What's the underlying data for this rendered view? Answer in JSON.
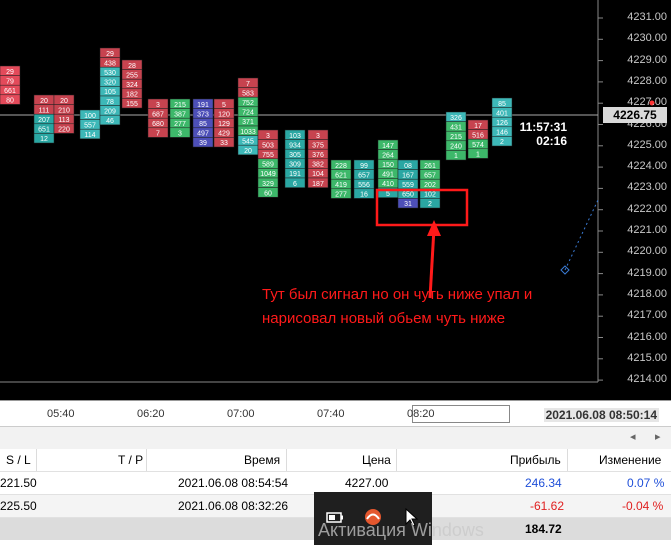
{
  "price_axis": {
    "ticks": [
      "4231.00",
      "4230.00",
      "4229.00",
      "4228.00",
      "4227.00",
      "4226.00",
      "4225.00",
      "4224.00",
      "4223.00",
      "4222.00",
      "4221.00",
      "4220.00",
      "4219.00",
      "4218.00",
      "4217.00",
      "4216.00",
      "4215.00",
      "4214.00"
    ],
    "current_price": "4226.75"
  },
  "candle_timer": {
    "time": "11:57:31",
    "remaining": "02:16"
  },
  "annotation": {
    "line1": "Тут был сигнал но он чуть ниже упал и",
    "line2": "нарисовал новый обьем чуть ниже"
  },
  "time_axis": {
    "ticks": [
      "05:40",
      "06:20",
      "07:00",
      "07:40",
      "08:20"
    ],
    "current_datetime": "2021.06.08 08:50:14"
  },
  "table": {
    "headers": {
      "sl": "S / L",
      "tp": "T / P",
      "time": "Время",
      "price": "Цена",
      "profit": "Прибыль",
      "change": "Изменение"
    },
    "rows": [
      {
        "sl": "221.50",
        "tp": "",
        "time": "2021.06.08 08:54:54",
        "price": "4227.00",
        "profit": "246.34",
        "change": "0.07 %"
      },
      {
        "sl": "225.50",
        "tp": "",
        "time": "2021.06.08 08:32:26",
        "price": "",
        "profit": "-61.62",
        "change": "-0.04 %"
      }
    ],
    "total_profit": "184.72"
  },
  "watermark": "Активация Windows",
  "taskbar_icons": [
    "battery-icon",
    "app-icon",
    "cursor-icon"
  ],
  "footprint_columns": [
    {
      "cells": [
        [
          "29",
          "#e34a5a"
        ],
        [
          "79",
          "#e34a5a"
        ],
        [
          "661",
          "#e34a5a"
        ],
        [
          "80",
          "#e34a5a"
        ]
      ]
    },
    {
      "cells": [
        [
          "20",
          "#c7434f"
        ],
        [
          "111",
          "#c7434f"
        ],
        [
          "207",
          "#2aa7a3"
        ],
        [
          "651",
          "#2aa7a3"
        ],
        [
          "12",
          "#2aa7a3"
        ]
      ]
    },
    {
      "cells": [
        [
          "20",
          "#c7434f"
        ],
        [
          "210",
          "#c7434f"
        ],
        [
          "113",
          "#c7434f"
        ],
        [
          "220",
          "#c7434f"
        ]
      ]
    },
    {
      "cells": [
        [
          "100",
          "#3db8b8"
        ],
        [
          "557",
          "#3db8b8"
        ],
        [
          "114",
          "#3db8b8"
        ]
      ]
    },
    {
      "cells": [
        [
          "29",
          "#c7434f"
        ],
        [
          "438",
          "#c7434f"
        ],
        [
          "530",
          "#3db8b8"
        ],
        [
          "320",
          "#3db8b8"
        ],
        [
          "105",
          "#3db8b8"
        ],
        [
          "78",
          "#3db8b8"
        ],
        [
          "209",
          "#3db8b8"
        ],
        [
          "46",
          "#3db8b8"
        ]
      ]
    },
    {
      "cells": [
        [
          "28",
          "#c7434f"
        ],
        [
          "255",
          "#c7434f"
        ],
        [
          "324",
          "#c7434f"
        ],
        [
          "182",
          "#c7434f"
        ],
        [
          "155",
          "#c7434f"
        ]
      ]
    },
    {
      "cells": [
        [
          "3",
          "#c7434f"
        ],
        [
          "687",
          "#c7434f"
        ],
        [
          "680",
          "#c7434f"
        ],
        [
          "7",
          "#c7434f"
        ]
      ]
    },
    {
      "cells": [
        [
          "215",
          "#3db86a"
        ],
        [
          "387",
          "#3db86a"
        ],
        [
          "277",
          "#3db86a"
        ],
        [
          "3",
          "#3db86a"
        ]
      ]
    },
    {
      "cells": [
        [
          "191",
          "#4d4fb8"
        ],
        [
          "373",
          "#4d4fb8"
        ],
        [
          "85",
          "#4d4fb8"
        ],
        [
          "497",
          "#4d4fb8"
        ],
        [
          "39",
          "#4d4fb8"
        ]
      ]
    },
    {
      "cells": [
        [
          "5",
          "#c7434f"
        ],
        [
          "120",
          "#c7434f"
        ],
        [
          "129",
          "#c7434f"
        ],
        [
          "429",
          "#c7434f"
        ],
        [
          "33",
          "#c7434f"
        ]
      ]
    },
    {
      "cells": [
        [
          "7",
          "#c7434f"
        ],
        [
          "583",
          "#c7434f"
        ],
        [
          "752",
          "#3db86a"
        ],
        [
          "724",
          "#3db86a"
        ],
        [
          "371",
          "#3db86a"
        ],
        [
          "1033",
          "#3db86a"
        ],
        [
          "545",
          "#3db8b8"
        ],
        [
          "20",
          "#3db8b8"
        ]
      ]
    },
    {
      "cells": [
        [
          "3",
          "#c7434f"
        ],
        [
          "503",
          "#c7434f"
        ],
        [
          "755",
          "#c7434f"
        ],
        [
          "589",
          "#3db86a"
        ],
        [
          "1049",
          "#3db86a"
        ],
        [
          "329",
          "#3db86a"
        ],
        [
          "60",
          "#3db86a"
        ]
      ]
    },
    {
      "cells": [
        [
          "103",
          "#2aa7a3"
        ],
        [
          "934",
          "#2aa7a3"
        ],
        [
          "305",
          "#2aa7a3"
        ],
        [
          "309",
          "#2aa7a3"
        ],
        [
          "191",
          "#2aa7a3"
        ],
        [
          "6",
          "#2aa7a3"
        ]
      ]
    },
    {
      "cells": [
        [
          "3",
          "#c7434f"
        ],
        [
          "375",
          "#c7434f"
        ],
        [
          "376",
          "#c7434f"
        ],
        [
          "382",
          "#c7434f"
        ],
        [
          "104",
          "#c7434f"
        ],
        [
          "187",
          "#c7434f"
        ]
      ]
    },
    {
      "cells": [
        [
          "228",
          "#3db86a"
        ],
        [
          "621",
          "#3db86a"
        ],
        [
          "419",
          "#3db86a"
        ],
        [
          "277",
          "#3db86a"
        ]
      ]
    },
    {
      "cells": [
        [
          "99",
          "#2aa7a3"
        ],
        [
          "657",
          "#2aa7a3"
        ],
        [
          "556",
          "#2aa7a3"
        ],
        [
          "16",
          "#2aa7a3"
        ]
      ]
    },
    {
      "cells": [
        [
          "147",
          "#3db86a"
        ],
        [
          "264",
          "#3db86a"
        ],
        [
          "150",
          "#3db86a"
        ],
        [
          "491",
          "#3db86a"
        ],
        [
          "410",
          "#3db86a"
        ],
        [
          "5",
          "#2aa7a3"
        ]
      ]
    },
    {
      "cells": [
        [
          "08",
          "#2aa7a3"
        ],
        [
          "167",
          "#2aa7a3"
        ],
        [
          "559",
          "#2aa7a3"
        ],
        [
          "650",
          "#2aa7a3"
        ],
        [
          "31",
          "#4d4fb8"
        ]
      ]
    },
    {
      "cells": [
        [
          "261",
          "#3db86a"
        ],
        [
          "657",
          "#3db86a"
        ],
        [
          "202",
          "#3db86a"
        ],
        [
          "102",
          "#2aa7a3"
        ],
        [
          "2",
          "#2aa7a3"
        ]
      ]
    },
    {
      "cells": [
        [
          "326",
          "#3db8b8"
        ],
        [
          "431",
          "#3db86a"
        ],
        [
          "215",
          "#3db86a"
        ],
        [
          "240",
          "#3db86a"
        ],
        [
          "1",
          "#3db86a"
        ]
      ]
    },
    {
      "cells": [
        [
          "17",
          "#c7434f"
        ],
        [
          "516",
          "#c7434f"
        ],
        [
          "574",
          "#3db86a"
        ],
        [
          "1",
          "#3db86a"
        ]
      ]
    },
    {
      "cells": [
        [
          "85",
          "#3db8b8"
        ],
        [
          "401",
          "#3db8b8"
        ],
        [
          "126",
          "#3db8b8"
        ],
        [
          "146",
          "#3db8b8"
        ],
        [
          "2",
          "#3db8b8"
        ]
      ]
    }
  ]
}
